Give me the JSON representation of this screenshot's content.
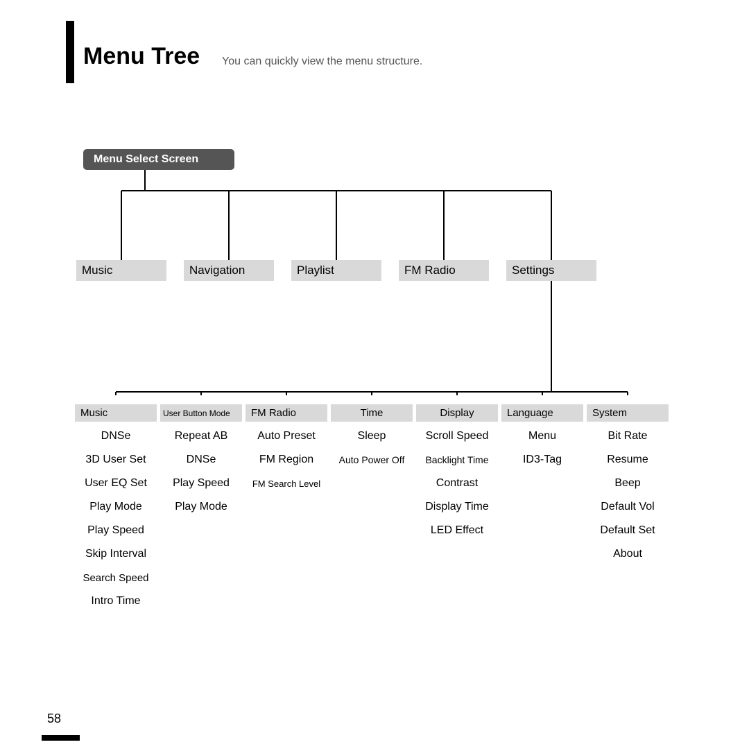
{
  "title": "Menu Tree",
  "subtitle": "You can quickly view the menu structure.",
  "page": "58",
  "root": "Menu Select Screen",
  "level1": [
    "Music",
    "Navigation",
    "Playlist",
    "FM Radio",
    "Settings"
  ],
  "level2": [
    "Music",
    "User Button Mode",
    "FM Radio",
    "Time",
    "Display",
    "Language",
    "System"
  ],
  "col0": [
    "DNSe",
    "3D User Set",
    "User EQ Set",
    "Play Mode",
    "Play Speed",
    "Skip Interval",
    "Search Speed",
    "Intro Time"
  ],
  "col1": [
    "Repeat AB",
    "DNSe",
    "Play Speed",
    "Play Mode"
  ],
  "col2": [
    "Auto Preset",
    "FM Region",
    "FM Search Level"
  ],
  "col3": [
    "Sleep",
    "Auto Power Off"
  ],
  "col4": [
    "Scroll Speed",
    "Backlight Time",
    "Contrast",
    "Display Time",
    "LED Effect"
  ],
  "col5": [
    "Menu",
    "ID3-Tag"
  ],
  "col6": [
    "Bit Rate",
    "Resume",
    "Beep",
    "Default Vol",
    "Default Set",
    "About"
  ]
}
